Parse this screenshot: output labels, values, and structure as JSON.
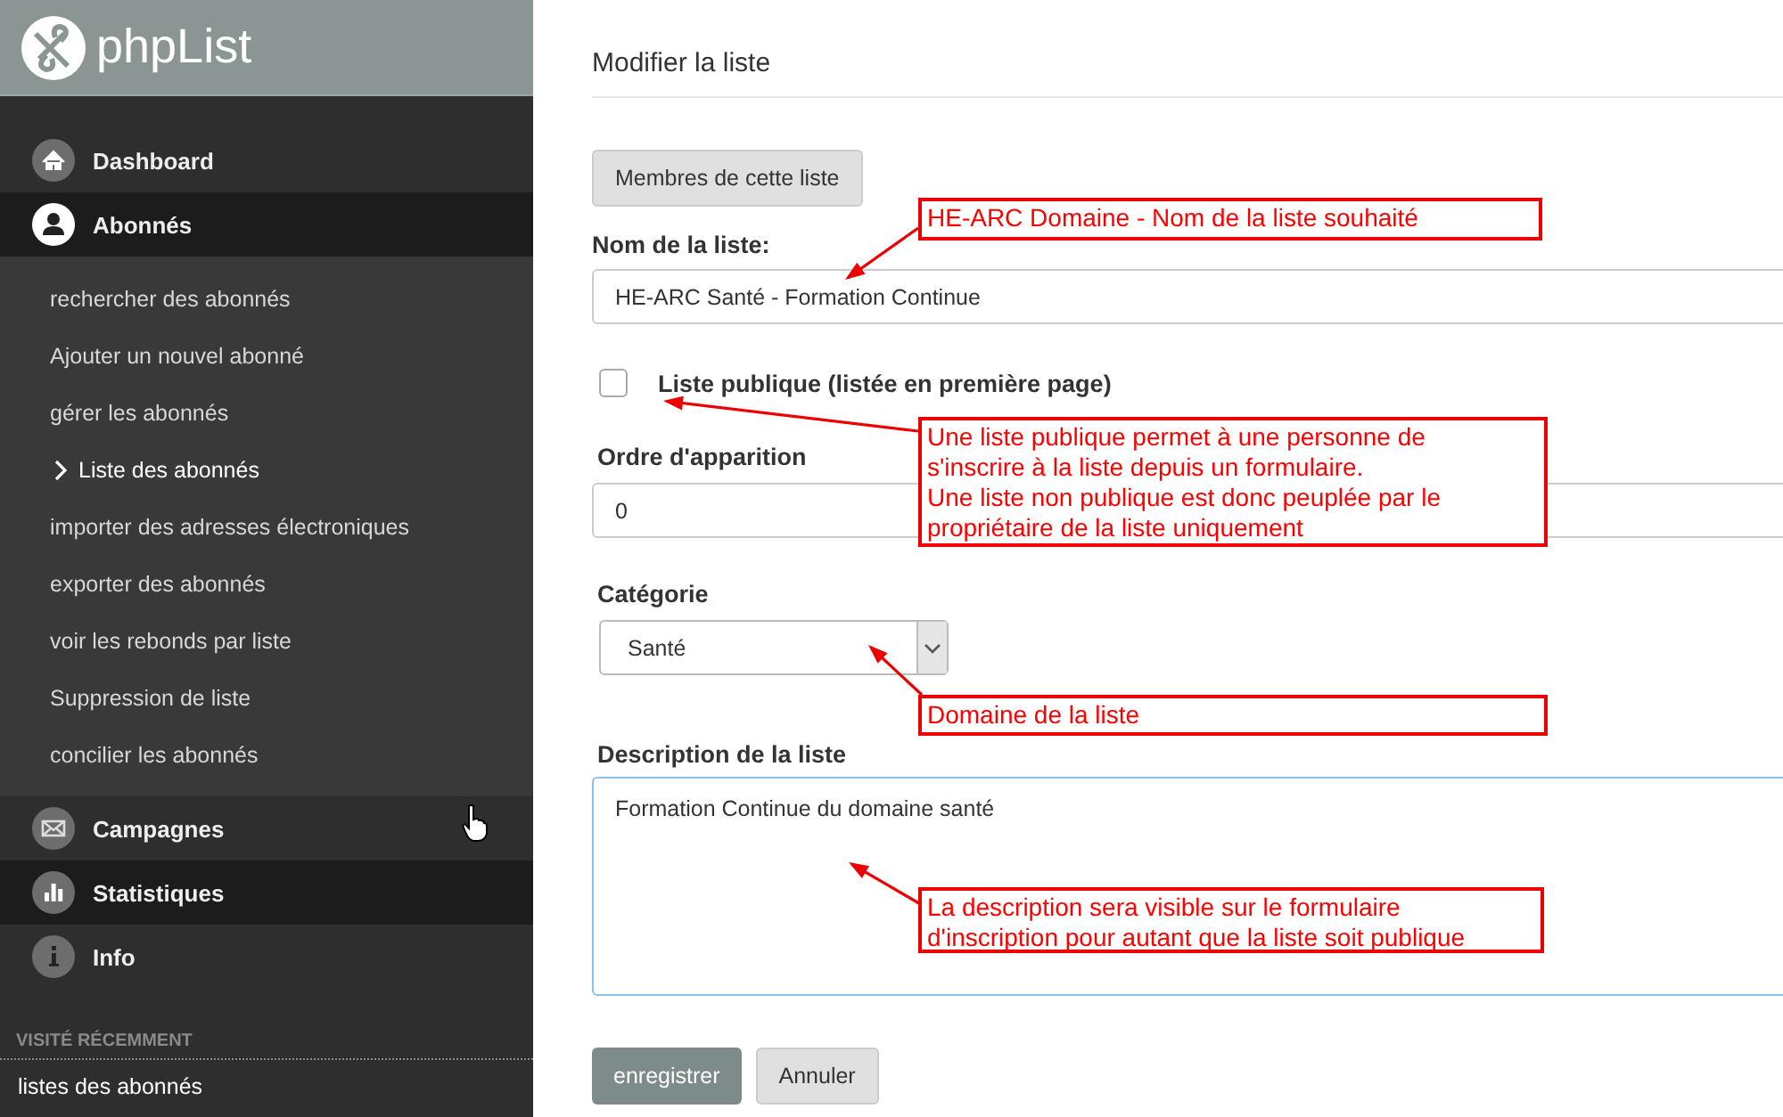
{
  "sidebar": {
    "logo": "phpList",
    "nav": [
      {
        "label": "Dashboard",
        "highlighted": false
      },
      {
        "label": "Abonnés",
        "highlighted": true,
        "children": [
          {
            "label": "rechercher des abonnés",
            "selected": false
          },
          {
            "label": "Ajouter un nouvel abonné",
            "selected": false
          },
          {
            "label": "gérer les abonnés",
            "selected": false
          },
          {
            "label": "Liste des abonnés",
            "selected": true
          },
          {
            "label": "importer des adresses électroniques",
            "selected": false
          },
          {
            "label": "exporter des abonnés",
            "selected": false
          },
          {
            "label": "voir les rebonds par liste",
            "selected": false
          },
          {
            "label": "Suppression de liste",
            "selected": false
          },
          {
            "label": "concilier les abonnés",
            "selected": false
          }
        ]
      },
      {
        "label": "Campagnes",
        "highlighted": false
      },
      {
        "label": "Statistiques",
        "highlighted": true
      },
      {
        "label": "Info",
        "highlighted": false
      }
    ],
    "recent": {
      "heading": "VISITÉ RÉCEMMENT",
      "items": [
        "listes des abonnés"
      ]
    }
  },
  "form": {
    "title": "Modifier la liste",
    "members_button": "Membres de cette liste",
    "name": {
      "label": "Nom de la liste:",
      "value": "HE-ARC Santé - Formation Continue"
    },
    "public": {
      "label": "Liste publique (listée en première page)",
      "checked": false
    },
    "order": {
      "label": "Ordre d'apparition",
      "value": "0"
    },
    "category": {
      "label": "Catégorie",
      "value": "Santé"
    },
    "description": {
      "label": "Description de la liste",
      "value": "Formation Continue du domaine santé"
    },
    "buttons": [
      "enregistrer",
      "Annuler"
    ]
  },
  "annotations": [
    {
      "lines": [
        "HE-ARC Domaine - Nom de la liste souhaité"
      ]
    },
    {
      "lines": [
        "Une liste publique permet à une personne de",
        "s'inscrire à la liste depuis un formulaire.",
        "Une liste non publique est donc peuplée par le",
        "propriétaire de la liste uniquement"
      ]
    },
    {
      "lines": [
        "Domaine de la liste"
      ]
    },
    {
      "lines": [
        "La description sera visible sur le formulaire",
        "d'inscription pour autant que la liste soit publique"
      ]
    }
  ]
}
